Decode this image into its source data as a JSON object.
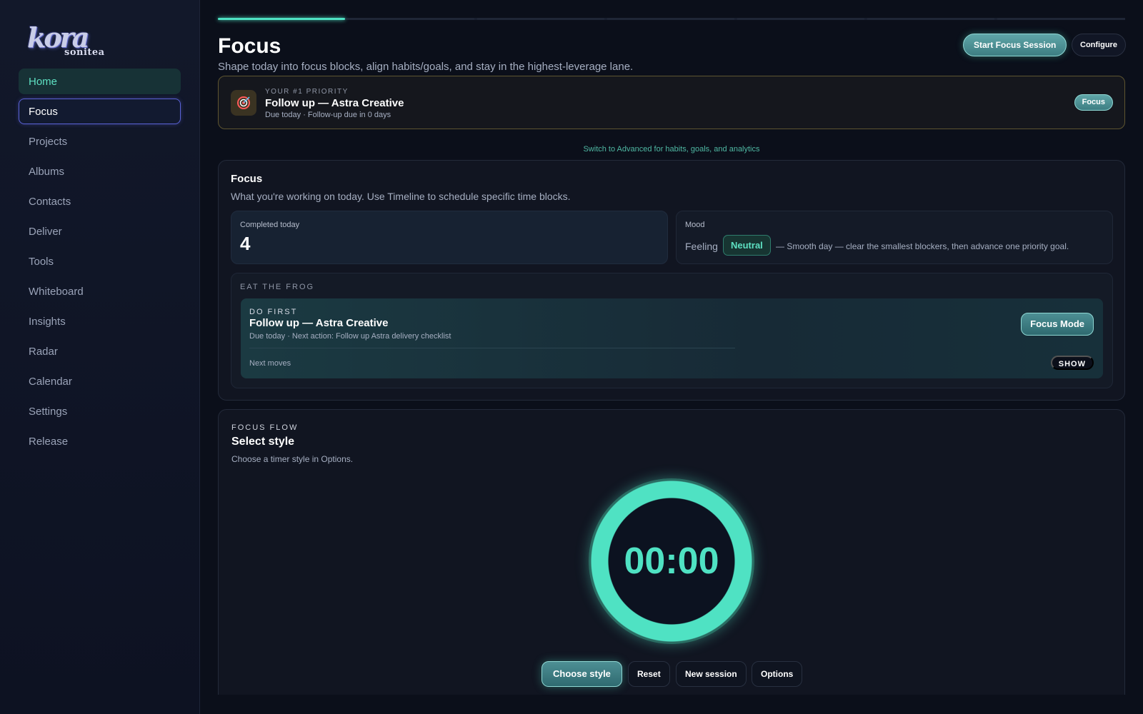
{
  "brand": {
    "logo_main": "kora",
    "logo_sub": "sonitea"
  },
  "sidebar": {
    "items": [
      {
        "label": "Home"
      },
      {
        "label": "Focus"
      },
      {
        "label": "Projects"
      },
      {
        "label": "Albums"
      },
      {
        "label": "Contacts"
      },
      {
        "label": "Deliver"
      },
      {
        "label": "Tools"
      },
      {
        "label": "Whiteboard"
      },
      {
        "label": "Insights"
      },
      {
        "label": "Radar"
      },
      {
        "label": "Calendar"
      },
      {
        "label": "Settings"
      },
      {
        "label": "Release"
      }
    ]
  },
  "header": {
    "title": "Focus",
    "subtitle": "Shape today into focus blocks, align habits/goals, and stay in the highest-leverage lane.",
    "start_session_label": "Start Focus Session",
    "configure_label": "Configure",
    "step_progress_fraction": 0.14
  },
  "priority": {
    "eyebrow": "YOUR #1 PRIORITY",
    "icon": "target-icon",
    "title": "Follow up — Astra Creative",
    "meta": "Due today · Follow-up due in 0 days",
    "button_label": "Focus"
  },
  "switch_link": "Switch to Advanced for habits, goals, and analytics",
  "focus_card": {
    "title": "Focus",
    "subtitle": "What you're working on today. Use Timeline to schedule specific time blocks.",
    "completed_label": "Completed today",
    "completed_value": "4",
    "mood_label": "Mood",
    "mood_feeling": "Feeling",
    "mood_value": "Neutral",
    "mood_desc": "— Smooth day — clear the smallest blockers, then advance one priority goal.",
    "frog": {
      "eyebrow": "EAT THE FROG",
      "do_first": "DO FIRST",
      "title": "Follow up — Astra Creative",
      "meta": "Due today · Next action: Follow up Astra delivery checklist",
      "next_moves": "Next moves",
      "focus_mode_label": "Focus Mode",
      "show_label": "SHOW"
    }
  },
  "flow": {
    "eyebrow": "FOCUS FLOW",
    "title": "Select style",
    "subtitle": "Choose a timer style in Options.",
    "timer": "00:00",
    "buttons": {
      "choose_style": "Choose style",
      "reset": "Reset",
      "new_session": "New session",
      "options": "Options"
    }
  },
  "colors": {
    "accent": "#4fe2c3",
    "active_border": "#5a62d6",
    "priority_border": "#5e5530",
    "background": "#0b0f1a"
  }
}
